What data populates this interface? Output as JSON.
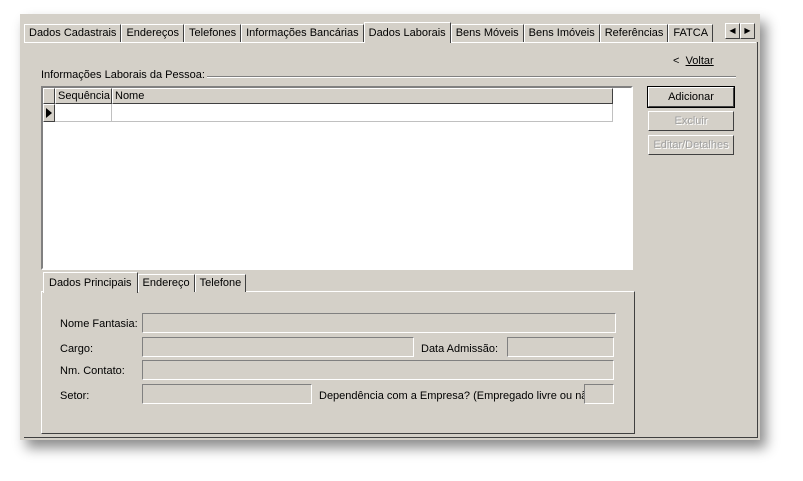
{
  "tabs": [
    "Dados Cadastrais",
    "Endereços",
    "Telefones",
    "Informações Bancárias",
    "Dados Laborais",
    "Bens Móveis",
    "Bens Imóveis",
    "Referências",
    "FATCA"
  ],
  "active_tab": "Dados Laborais",
  "tab_scroll": {
    "left": "◀",
    "right": "▶"
  },
  "voltar": {
    "prefix": "<",
    "label": "Voltar"
  },
  "group_title": "Informações Laborais da Pessoa:",
  "grid": {
    "columns": [
      "Sequência",
      "Nome"
    ],
    "rows": [
      [
        "",
        ""
      ]
    ]
  },
  "buttons": {
    "add": "Adicionar",
    "delete": "Excluir",
    "edit": "Editar/Detalhes"
  },
  "sub_tabs": [
    "Dados Principais",
    "Endereço",
    "Telefone"
  ],
  "form": {
    "nome_fantasia": "Nome Fantasia:",
    "cargo": "Cargo:",
    "data_admissao": "Data Admissão:",
    "nm_contato": "Nm. Contato:",
    "setor": "Setor:",
    "dependencia": "Dependência com a Empresa? (Empregado livre ou não)"
  }
}
